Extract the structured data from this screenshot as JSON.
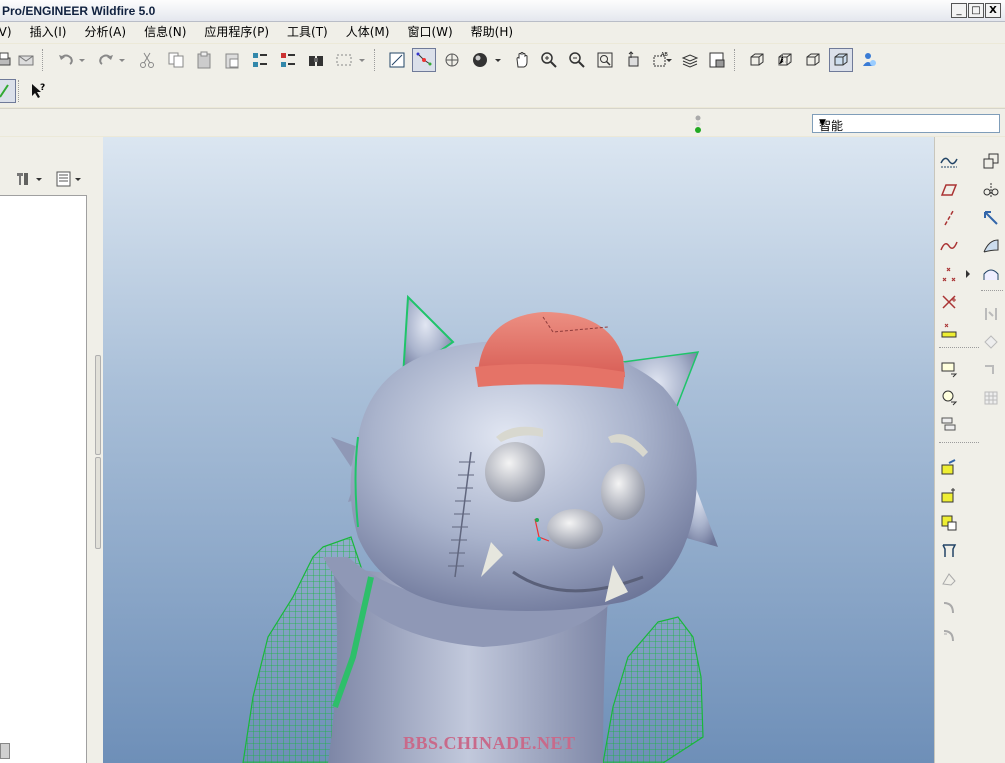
{
  "window": {
    "title": "Pro/ENGINEER Wildfire 5.0",
    "minimize": "_",
    "restore": "□",
    "close": "X"
  },
  "menu": [
    "(V)",
    "插入(I)",
    "分析(A)",
    "信息(N)",
    "应用程序(P)",
    "工具(T)",
    "人体(M)",
    "窗口(W)",
    "帮助(H)"
  ],
  "filter": {
    "selected": "智能"
  },
  "watermark": "BBS.CHINADE.NET",
  "colors": {
    "model_body": "#a9b3cc",
    "cap": "#ee8478",
    "wireframe": "#18b83a"
  }
}
